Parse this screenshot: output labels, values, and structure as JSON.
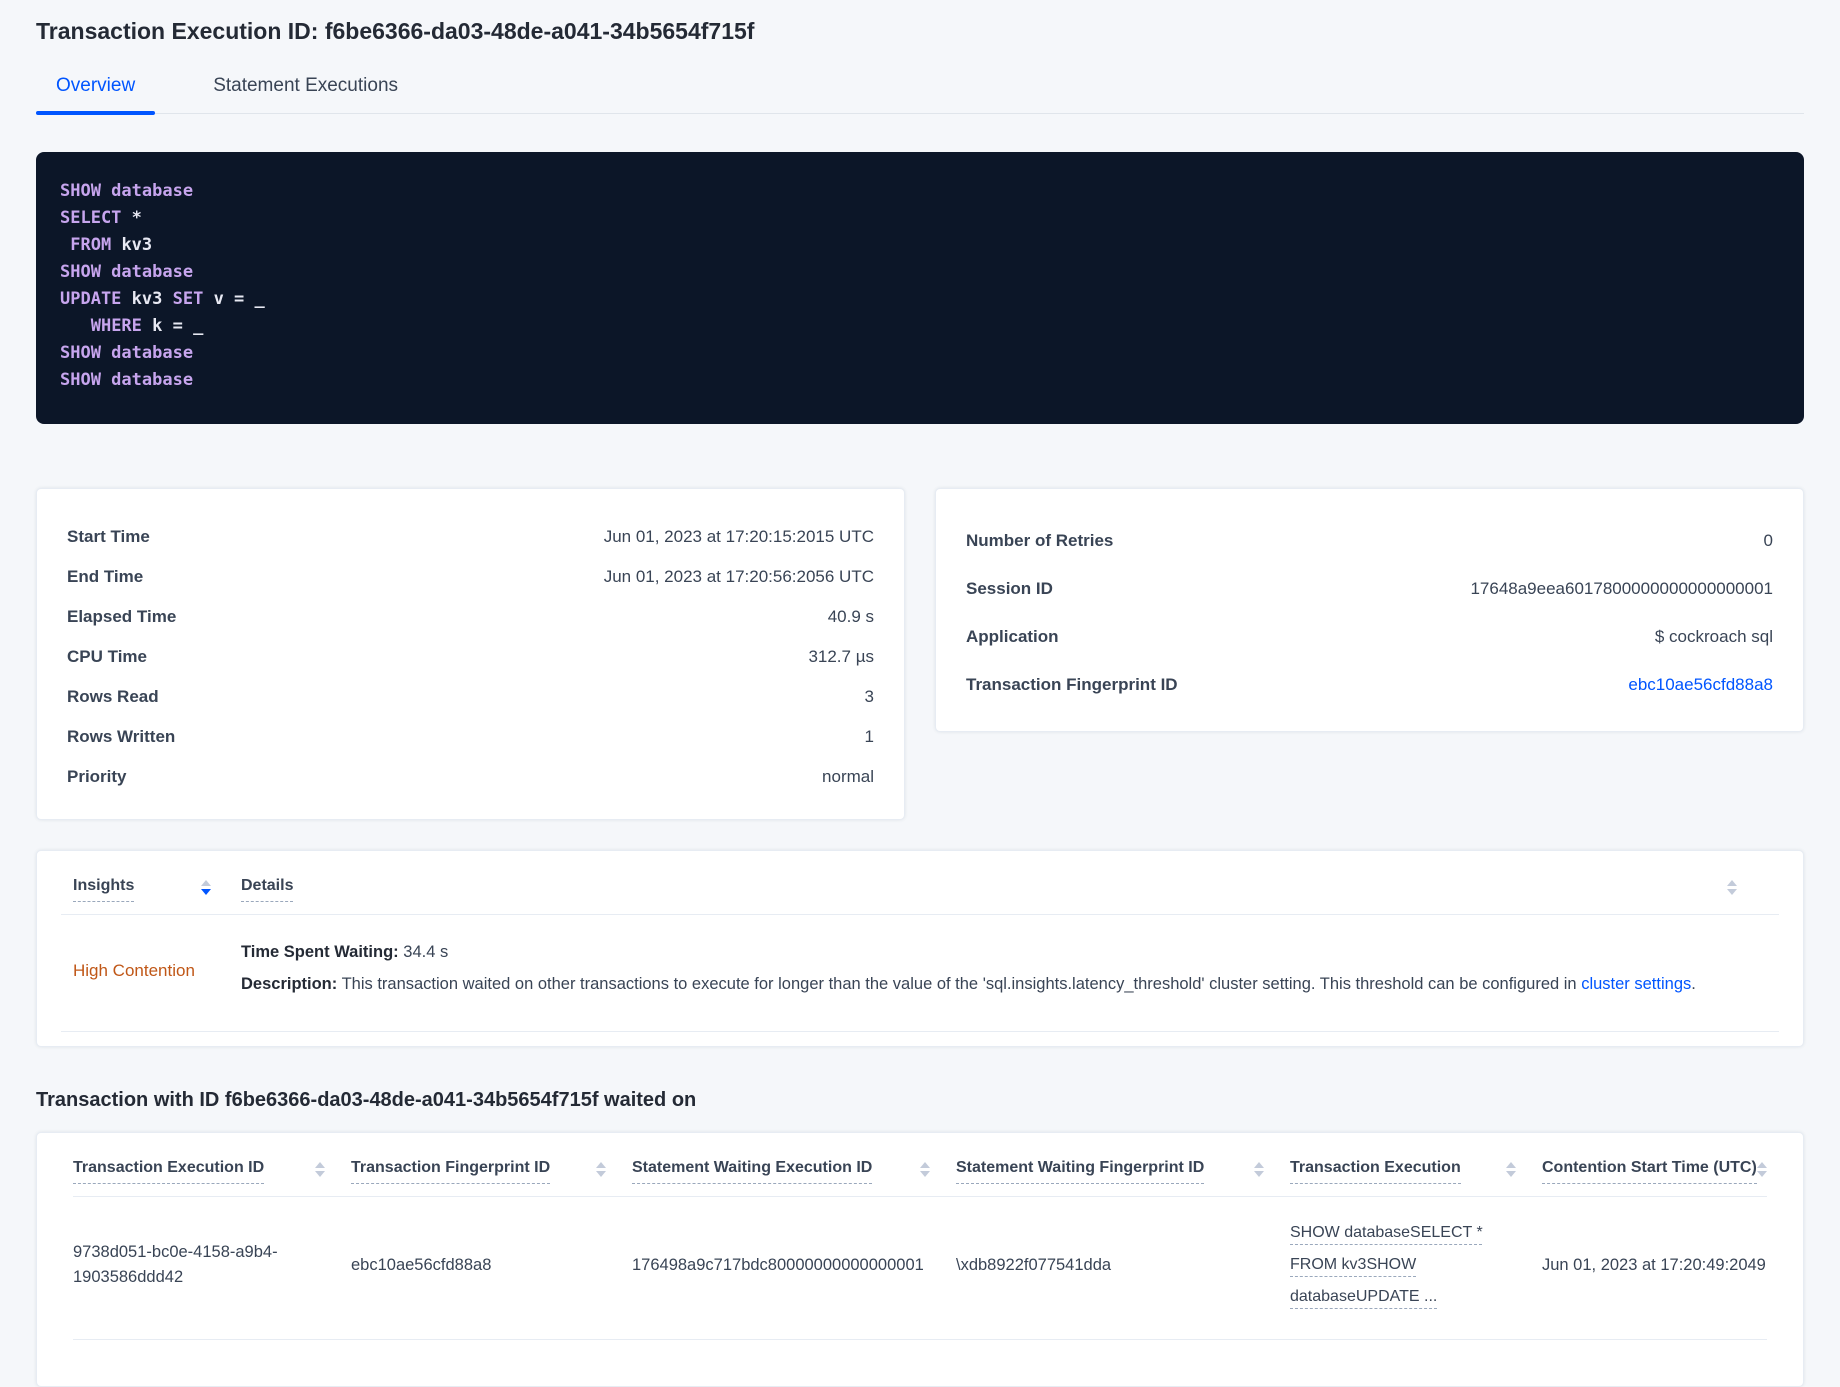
{
  "page": {
    "title": "Transaction Execution ID: f6be6366-da03-48de-a041-34b5654f715f"
  },
  "tabs": {
    "overview": "Overview",
    "statement_executions": "Statement Executions"
  },
  "colors": {
    "accent_blue": "#0055ff",
    "insight_orange": "#c05717",
    "code_background": "#0c1628",
    "code_keyword": "#c7a5ee",
    "code_text": "#e8e9f3"
  },
  "sql": {
    "lines": [
      [
        {
          "t": "kw",
          "v": "SHOW database"
        }
      ],
      [
        {
          "t": "kw",
          "v": "SELECT"
        },
        {
          "t": "pl",
          "v": " *"
        }
      ],
      [
        {
          "t": "pl",
          "v": " "
        },
        {
          "t": "kw",
          "v": "FROM"
        },
        {
          "t": "pl",
          "v": " kv3"
        }
      ],
      [
        {
          "t": "kw",
          "v": "SHOW database"
        }
      ],
      [
        {
          "t": "kw",
          "v": "UPDATE"
        },
        {
          "t": "pl",
          "v": " kv3 "
        },
        {
          "t": "kw",
          "v": "SET"
        },
        {
          "t": "pl",
          "v": " v = _"
        }
      ],
      [
        {
          "t": "pl",
          "v": "   "
        },
        {
          "t": "kw",
          "v": "WHERE"
        },
        {
          "t": "pl",
          "v": " k = _"
        }
      ],
      [
        {
          "t": "kw",
          "v": "SHOW database"
        }
      ],
      [
        {
          "t": "kw",
          "v": "SHOW database"
        }
      ]
    ]
  },
  "execution_stats": {
    "rows": [
      {
        "label": "Start Time",
        "value": "Jun 01, 2023 at 17:20:15:2015 UTC"
      },
      {
        "label": "End Time",
        "value": "Jun 01, 2023 at 17:20:56:2056 UTC"
      },
      {
        "label": "Elapsed Time",
        "value": "40.9 s"
      },
      {
        "label": "CPU Time",
        "value": "312.7 µs"
      },
      {
        "label": "Rows Read",
        "value": "3"
      },
      {
        "label": "Rows Written",
        "value": "1"
      },
      {
        "label": "Priority",
        "value": "normal"
      }
    ]
  },
  "session_info": {
    "rows": [
      {
        "label": "Number of Retries",
        "value": "0"
      },
      {
        "label": "Session ID",
        "value": "17648a9eea6017800000000000000001"
      },
      {
        "label": "Application",
        "value": "$ cockroach sql"
      }
    ],
    "fingerprint_label": "Transaction Fingerprint ID",
    "fingerprint_value": "ebc10ae56cfd88a8"
  },
  "insights": {
    "col_insights": "Insights",
    "col_details": "Details",
    "row": {
      "type": "High Contention",
      "waiting_label": "Time Spent Waiting:",
      "waiting_value": "34.4 s",
      "description_label": "Description:",
      "description_text": "This transaction waited on other transactions to execute for longer than the value of the 'sql.insights.latency_threshold' cluster setting. This threshold can be configured in",
      "link_text": "cluster settings",
      "link_suffix": "."
    }
  },
  "waited_on": {
    "heading": "Transaction with ID f6be6366-da03-48de-a041-34b5654f715f waited on",
    "columns": [
      "Transaction Execution ID",
      "Transaction Fingerprint ID",
      "Statement Waiting Execution ID",
      "Statement Waiting Fingerprint ID",
      "Transaction Execution",
      "Contention Start Time (UTC)"
    ],
    "row": {
      "transaction_execution_id": "9738d051-bc0e-4158-a9b4-1903586ddd42",
      "transaction_fingerprint_id": "ebc10ae56cfd88a8",
      "statement_waiting_execution_id": "176498a9c717bdc80000000000000001",
      "statement_waiting_fingerprint_id": "\\xdb8922f077541dda",
      "transaction_execution_lines": [
        "SHOW databaseSELECT *",
        "FROM kv3SHOW",
        "databaseUPDATE ..."
      ],
      "contention_start_time": "Jun 01, 2023 at 17:20:49:2049"
    }
  }
}
